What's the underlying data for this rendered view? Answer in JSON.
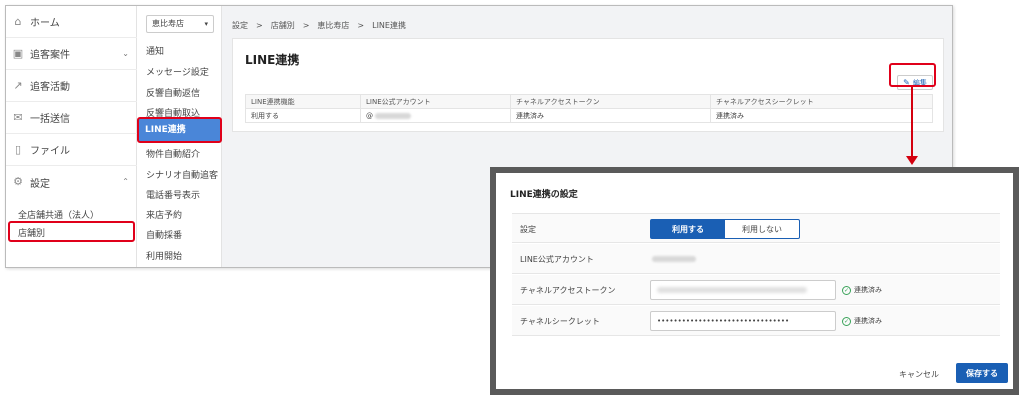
{
  "sidebar": {
    "items": [
      {
        "label": "ホーム",
        "icon": "home-icon"
      },
      {
        "label": "追客案件",
        "icon": "case-icon"
      },
      {
        "label": "追客活動",
        "icon": "activity-icon"
      },
      {
        "label": "一括送信",
        "icon": "mail-icon"
      },
      {
        "label": "ファイル",
        "icon": "file-icon"
      },
      {
        "label": "設定",
        "icon": "gear-icon"
      }
    ],
    "sub_items": [
      "全店舗共通（法人）",
      "店舗別"
    ]
  },
  "submenu": {
    "store_select": "恵比寿店",
    "items": [
      "通知",
      "メッセージ設定",
      "反響自動返信",
      "反響自動取込",
      "LINE連携",
      "物件自動紹介",
      "シナリオ自動追客",
      "電話番号表示",
      "来店予約",
      "自動採番",
      "利用開始"
    ],
    "active": "LINE連携"
  },
  "breadcrumb": "設定　>　店舗別　>　恵比寿店　>　LINE連携",
  "card": {
    "title": "LINE連携",
    "edit_label": "編集",
    "table": {
      "headers": [
        "LINE連携機能",
        "LINE公式アカウント",
        "チャネルアクセストークン",
        "チャネルアクセスシークレット"
      ],
      "row": [
        "利用する",
        "@",
        "連携済み",
        "連携済み"
      ]
    }
  },
  "modal": {
    "title": "LINE連携の設定",
    "rows": {
      "setting_label": "設定",
      "toggle_on": "利用する",
      "toggle_off": "利用しない",
      "account_label": "LINE公式アカウント",
      "token_label": "チャネルアクセストークン",
      "token_status": "連携済み",
      "secret_label": "チャネルシークレット",
      "secret_value": "••••••••••••••••••••••••••••••••",
      "secret_status": "連携済み"
    },
    "cancel_label": "キャンセル",
    "save_label": "保存する"
  },
  "colors": {
    "accent": "#1a5fb4",
    "highlight": "#e0001a",
    "active_menu": "#4a86d8",
    "success": "#3aa35a"
  }
}
